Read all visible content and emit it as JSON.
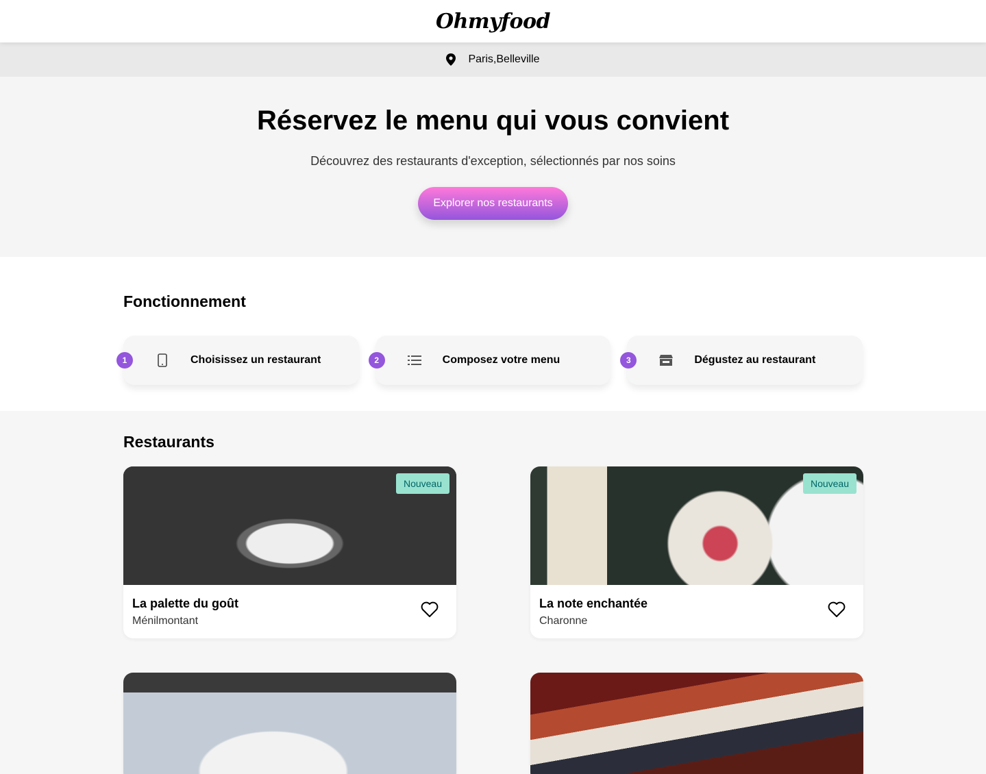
{
  "header": {
    "logo": "Ohmyfood"
  },
  "location": {
    "text": "Paris,Belleville",
    "icon": "location-pin-icon"
  },
  "hero": {
    "title": "Réservez le menu qui vous convient",
    "subtitle": "Découvrez des restaurants d'exception, sélectionnés par nos soins",
    "cta_label": "Explorer nos restaurants"
  },
  "how": {
    "title": "Fonctionnement",
    "steps": [
      {
        "number": "1",
        "label": "Choisissez un restaurant",
        "icon": "phone-icon"
      },
      {
        "number": "2",
        "label": "Composez votre menu",
        "icon": "list-icon"
      },
      {
        "number": "3",
        "label": "Dégustez au restaurant",
        "icon": "store-icon"
      }
    ]
  },
  "restaurants": {
    "title": "Restaurants",
    "items": [
      {
        "name": "La palette du goût",
        "area": "Ménilmontant",
        "badge": "Nouveau"
      },
      {
        "name": "La note enchantée",
        "area": "Charonne",
        "badge": "Nouveau"
      },
      {
        "name": "",
        "area": "",
        "badge": ""
      },
      {
        "name": "",
        "area": "",
        "badge": ""
      }
    ]
  },
  "colors": {
    "accent": "#9356dc",
    "accent_light": "#ff79da",
    "badge_bg": "#99e2d0"
  }
}
